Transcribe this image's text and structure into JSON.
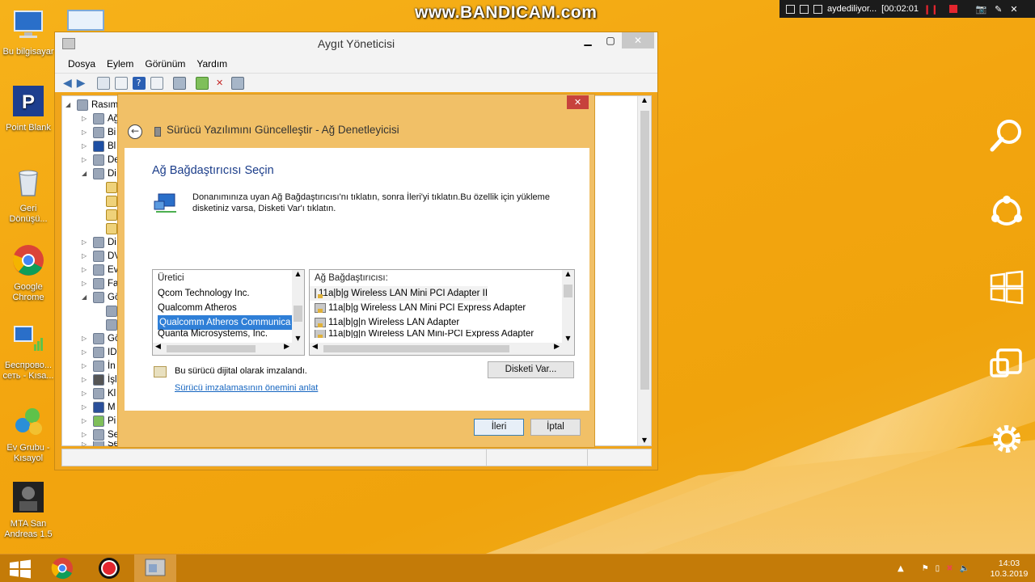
{
  "watermark": "www.BANDICAM.com",
  "recorder": {
    "status": "aydediliyor...",
    "time": "[00:02:01"
  },
  "desktop_icons": [
    {
      "label": "Bu bilgisayar",
      "icon": "computer-icon"
    },
    {
      "label": "Point Blank",
      "icon": "point-blank-icon"
    },
    {
      "label": "Geri Dönüşü...",
      "icon": "recycle-bin-icon"
    },
    {
      "label": "Google Chrome",
      "icon": "chrome-icon"
    },
    {
      "label": "Беспрово... сеть - Kısa...",
      "icon": "wireless-network-icon"
    },
    {
      "label": "Ev Grubu - Kısayol",
      "icon": "homegroup-icon"
    },
    {
      "label": "MTA San Andreas 1.5",
      "icon": "mta-icon"
    }
  ],
  "devmgr": {
    "title": "Aygıt Yöneticisi",
    "menu": [
      "Dosya",
      "Eylem",
      "Görünüm",
      "Yardım"
    ],
    "tree": [
      {
        "label": "Rasım",
        "expanded": true,
        "level": 0
      },
      {
        "label": "Ağ",
        "level": 1
      },
      {
        "label": "Bi",
        "level": 1
      },
      {
        "label": "Bl",
        "level": 1
      },
      {
        "label": "De",
        "level": 1
      },
      {
        "label": "Di",
        "expanded": true,
        "level": 1
      },
      {
        "label": "",
        "level": 2
      },
      {
        "label": "",
        "level": 2
      },
      {
        "label": "",
        "level": 2
      },
      {
        "label": "",
        "level": 2
      },
      {
        "label": "Di",
        "level": 1
      },
      {
        "label": "DV",
        "level": 1
      },
      {
        "label": "Ev",
        "level": 1
      },
      {
        "label": "Fa",
        "level": 1
      },
      {
        "label": "Gö",
        "expanded": true,
        "level": 1
      },
      {
        "label": "",
        "level": 2
      },
      {
        "label": "",
        "level": 2
      },
      {
        "label": "Gö",
        "level": 1
      },
      {
        "label": "ID",
        "level": 1
      },
      {
        "label": "İn",
        "level": 1
      },
      {
        "label": "İşl",
        "level": 1
      },
      {
        "label": "Kl",
        "level": 1
      },
      {
        "label": "M",
        "level": 1
      },
      {
        "label": "Pi",
        "level": 1
      },
      {
        "label": "Se",
        "level": 1
      },
      {
        "label": "Se",
        "level": 1
      }
    ]
  },
  "wizard": {
    "title": "Sürücü Yazılımını Güncelleştir - Ağ Denetleyicisi",
    "heading": "Ağ Bağdaştırıcısı Seçin",
    "description": "Donanımınıza uyan Ağ Bağdaştırıcısı'nı tıklatın, sonra İleri'yi tıklatın.Bu özellik için yükleme disketiniz varsa, Disketi Var'ı tıklatın.",
    "manufacturer_header": "Üretici",
    "manufacturers": [
      "Qcom Technology Inc.",
      "Qualcomm Atheros",
      "Qualcomm Atheros Communica",
      "Quanta Microsystems, Inc."
    ],
    "selected_manufacturer_index": 2,
    "adapter_header": "Ağ Bağdaştırıcısı:",
    "adapters": [
      "11a|b|g Wireless LAN Mini PCI Adapter II",
      "11a|b|g Wireless LAN Mini PCI Express Adapter",
      "11a|b|g|n Wireless LAN Adapter",
      "11a|b|g|n Wireless LAN Mini-PCI Express Adapter"
    ],
    "signed_text": "Bu sürücü dijital olarak imzalandı.",
    "signing_link": "Sürücü imzalamasının önemini anlat",
    "have_disk_button": "Disketi Var...",
    "next_button": "İleri",
    "cancel_button": "İptal",
    "close_glyph": "✕",
    "back_glyph": "←"
  },
  "taskbar": {
    "clock_time": "14:03",
    "clock_date": "10.3.2019"
  },
  "colors": {
    "wallpaper": "#f3a50f",
    "taskbar": "#c47b08",
    "selection": "#2f7fd7",
    "heading": "#1b3d8a",
    "link": "#1565c0"
  }
}
